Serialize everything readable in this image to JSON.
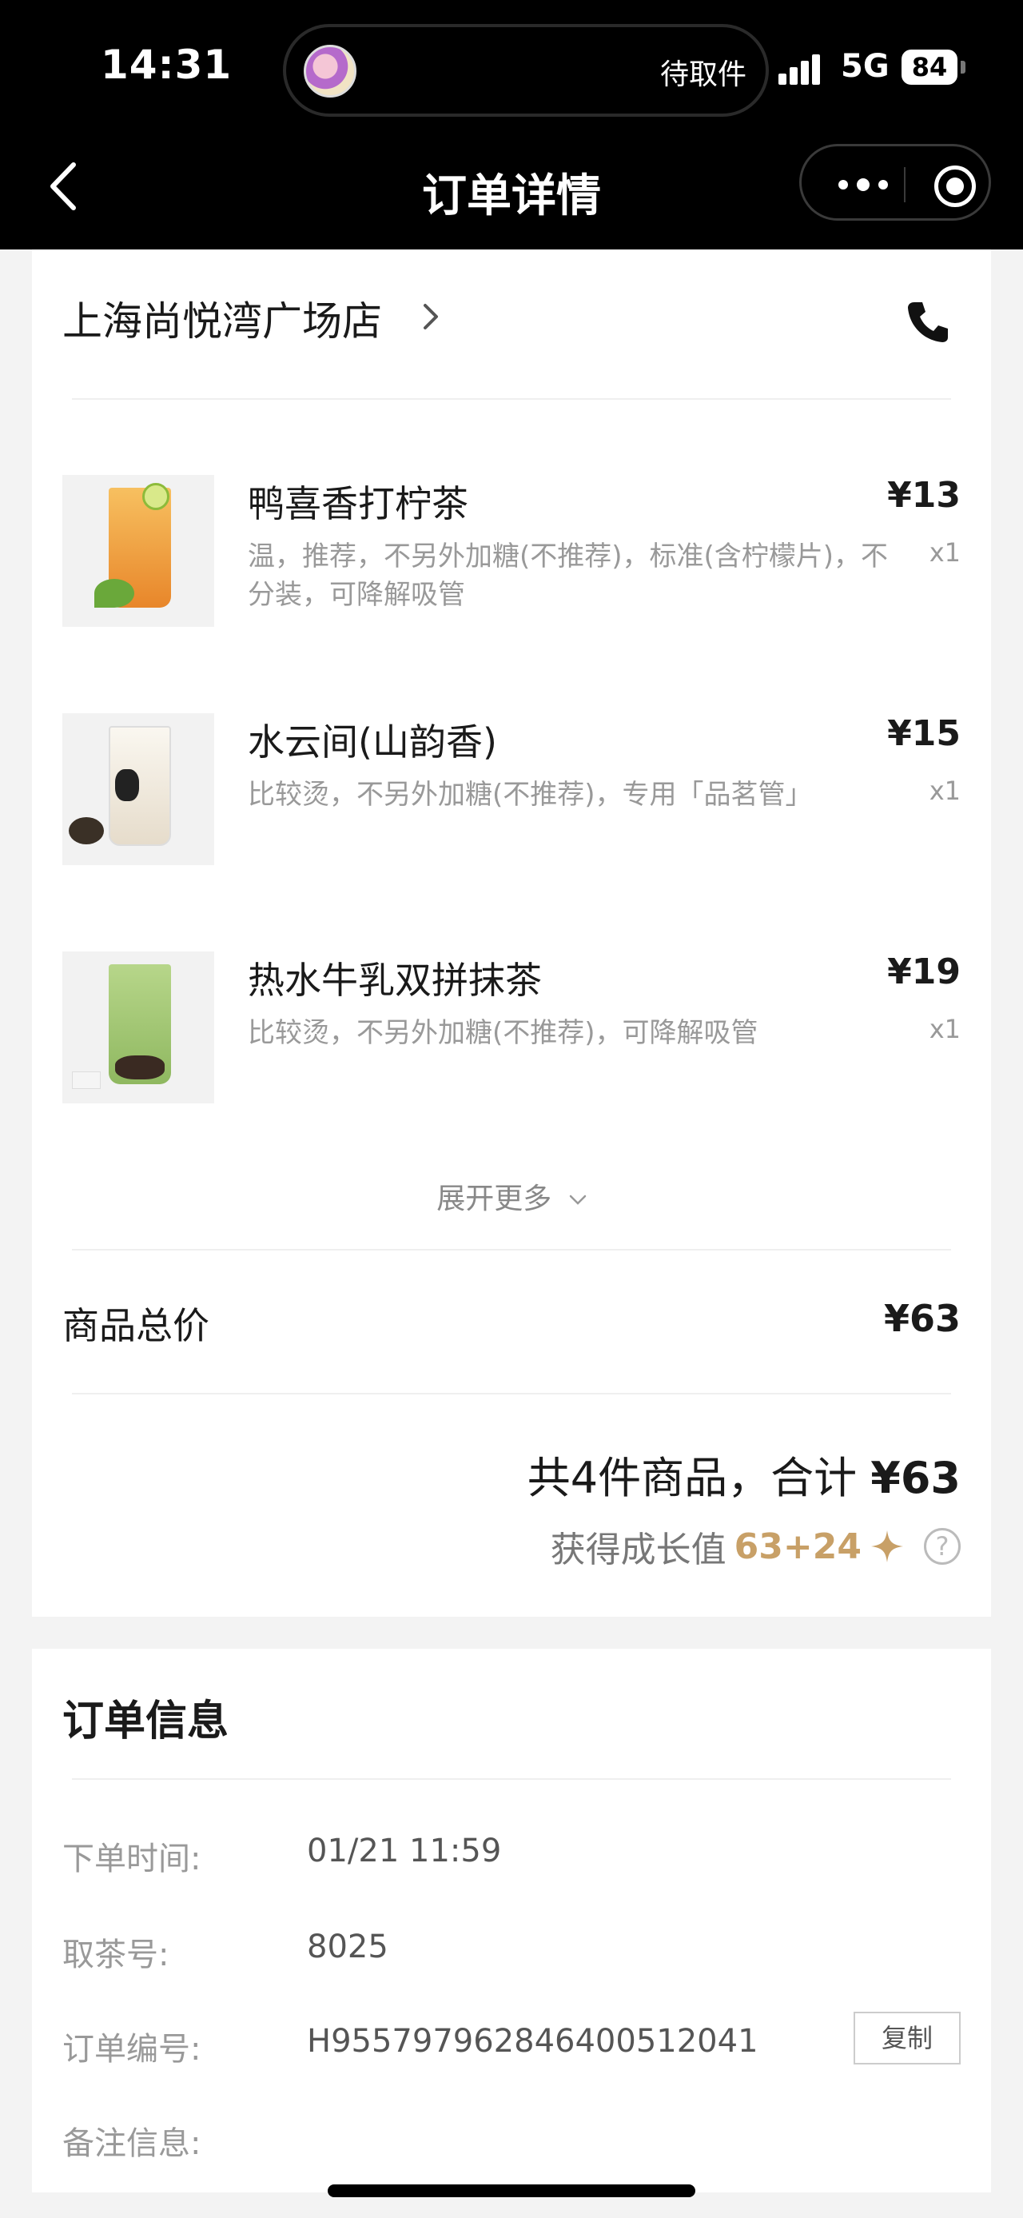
{
  "status_bar": {
    "time": "14:31",
    "live_activity_status": "待取件",
    "network": "5G",
    "battery": "84"
  },
  "nav": {
    "title": "订单详情",
    "back_icon": "chevron-left-icon",
    "more_icon": "more-dots-icon",
    "close_icon": "target-circle-icon"
  },
  "store": {
    "name": "上海尚悦湾广场店",
    "phone_icon": "phone-icon"
  },
  "items": [
    {
      "name": "鸭喜香打柠茶",
      "spec": "温，推荐，不另外加糖(不推荐)，标准(含柠檬片)，不分装，可降解吸管",
      "price": "¥13",
      "qty": "x1",
      "color": "#f0a23a"
    },
    {
      "name": "水云间(山韵香)",
      "spec": "比较烫，不另外加糖(不推荐)，专用「品茗管」",
      "price": "¥15",
      "qty": "x1",
      "color": "#efe6d4"
    },
    {
      "name": "热水牛乳双拼抹茶",
      "spec": "比较烫，不另外加糖(不推荐)，可降解吸管",
      "price": "¥19",
      "qty": "x1",
      "color": "#9cc46a"
    }
  ],
  "expand_label": "展开更多",
  "totals": {
    "goods_label": "商品总价",
    "goods_value": "¥63",
    "summary_prefix": "共4件商品，合计 ",
    "summary_total": "¥63",
    "growth_label": "获得成长值",
    "growth_value": "63+24"
  },
  "order_info": {
    "title": "订单信息",
    "rows": [
      {
        "label": "下单时间:",
        "value": "01/21 11:59"
      },
      {
        "label": "取茶号:",
        "value": "8025"
      },
      {
        "label": "订单编号:",
        "value": "H955797962846400512041"
      },
      {
        "label": "备注信息:",
        "value": ""
      }
    ],
    "copy_label": "复制"
  },
  "colors": {
    "accent_gold": "#c8a067",
    "nav_bg": "#000000"
  }
}
